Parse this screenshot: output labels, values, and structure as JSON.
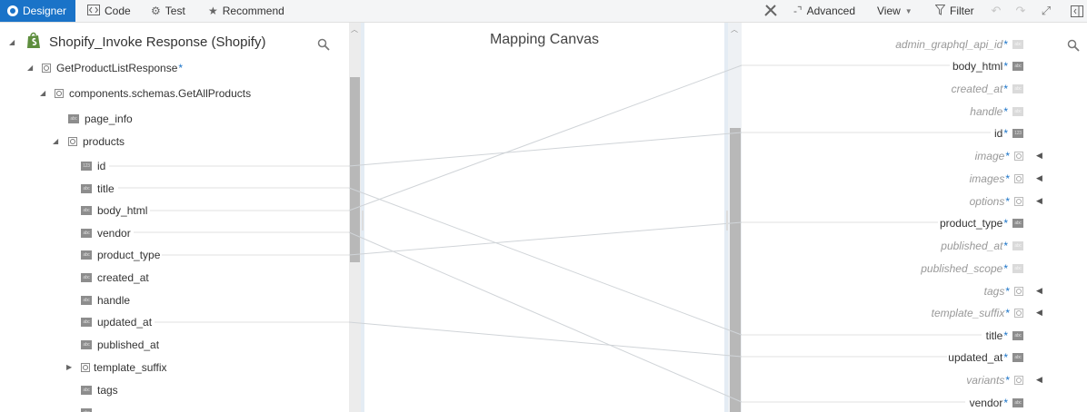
{
  "toolbar": {
    "designer": "Designer",
    "code": "Code",
    "test": "Test",
    "recommend": "Recommend",
    "advanced": "Advanced",
    "view": "View",
    "filter": "Filter"
  },
  "left": {
    "root": "Shopify_Invoke Response (Shopify)",
    "response": "GetProductListResponse",
    "schema": "components.schemas.GetAllProducts",
    "page_info": "page_info",
    "products": "products",
    "fields": [
      "id",
      "title",
      "body_html",
      "vendor",
      "product_type",
      "created_at",
      "handle",
      "updated_at",
      "published_at",
      "template_suffix",
      "tags"
    ]
  },
  "canvas": {
    "title": "Mapping Canvas"
  },
  "right": {
    "fields": [
      {
        "name": "admin_graphql_api_id",
        "required": true,
        "mapped": false,
        "kind": "text"
      },
      {
        "name": "body_html",
        "required": true,
        "mapped": true,
        "kind": "text"
      },
      {
        "name": "created_at",
        "required": true,
        "mapped": false,
        "kind": "text"
      },
      {
        "name": "handle",
        "required": true,
        "mapped": false,
        "kind": "text"
      },
      {
        "name": "id",
        "required": true,
        "mapped": true,
        "kind": "number"
      },
      {
        "name": "image",
        "required": true,
        "mapped": false,
        "kind": "object"
      },
      {
        "name": "images",
        "required": true,
        "mapped": false,
        "kind": "list"
      },
      {
        "name": "options",
        "required": true,
        "mapped": false,
        "kind": "object"
      },
      {
        "name": "product_type",
        "required": true,
        "mapped": true,
        "kind": "text"
      },
      {
        "name": "published_at",
        "required": true,
        "mapped": false,
        "kind": "text"
      },
      {
        "name": "published_scope",
        "required": true,
        "mapped": false,
        "kind": "text"
      },
      {
        "name": "tags",
        "required": true,
        "mapped": false,
        "kind": "list"
      },
      {
        "name": "template_suffix",
        "required": true,
        "mapped": false,
        "kind": "object"
      },
      {
        "name": "title",
        "required": true,
        "mapped": true,
        "kind": "text"
      },
      {
        "name": "updated_at",
        "required": true,
        "mapped": true,
        "kind": "text"
      },
      {
        "name": "variants",
        "required": true,
        "mapped": false,
        "kind": "object"
      },
      {
        "name": "vendor",
        "required": true,
        "mapped": true,
        "kind": "text"
      }
    ]
  },
  "colors": {
    "accent": "#1a73c8",
    "shopify_green": "#5e8e3e"
  }
}
